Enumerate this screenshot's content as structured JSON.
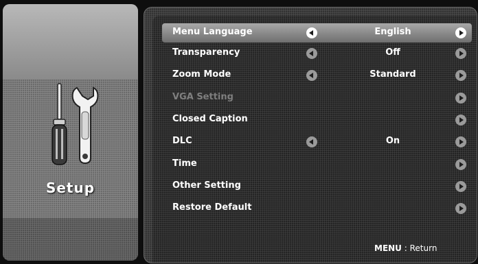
{
  "sidebar": {
    "title": "Setup",
    "icon": "tools-icon"
  },
  "menu": {
    "items": [
      {
        "label": "Menu Language",
        "value": "English",
        "selected": true,
        "enabled": true,
        "has_left_arrow": true,
        "has_right_arrow": true
      },
      {
        "label": "Transparency",
        "value": "Off",
        "selected": false,
        "enabled": true,
        "has_left_arrow": true,
        "has_right_arrow": true
      },
      {
        "label": "Zoom Mode",
        "value": "Standard",
        "selected": false,
        "enabled": true,
        "has_left_arrow": true,
        "has_right_arrow": true
      },
      {
        "label": "VGA Setting",
        "value": "",
        "selected": false,
        "enabled": false,
        "has_left_arrow": false,
        "has_right_arrow": true
      },
      {
        "label": "Closed Caption",
        "value": "",
        "selected": false,
        "enabled": true,
        "has_left_arrow": false,
        "has_right_arrow": true
      },
      {
        "label": "DLC",
        "value": "On",
        "selected": false,
        "enabled": true,
        "has_left_arrow": true,
        "has_right_arrow": true
      },
      {
        "label": "Time",
        "value": "",
        "selected": false,
        "enabled": true,
        "has_left_arrow": false,
        "has_right_arrow": true
      },
      {
        "label": "Other Setting",
        "value": "",
        "selected": false,
        "enabled": true,
        "has_left_arrow": false,
        "has_right_arrow": true
      },
      {
        "label": "Restore Default",
        "value": "",
        "selected": false,
        "enabled": true,
        "has_left_arrow": false,
        "has_right_arrow": true
      }
    ]
  },
  "footer": {
    "key": "MENU",
    "separator": " : ",
    "action": "Return"
  },
  "colors": {
    "selected_highlight": "#a8a8a8",
    "disabled_text": "#7f7f7f",
    "text": "#ffffff"
  }
}
